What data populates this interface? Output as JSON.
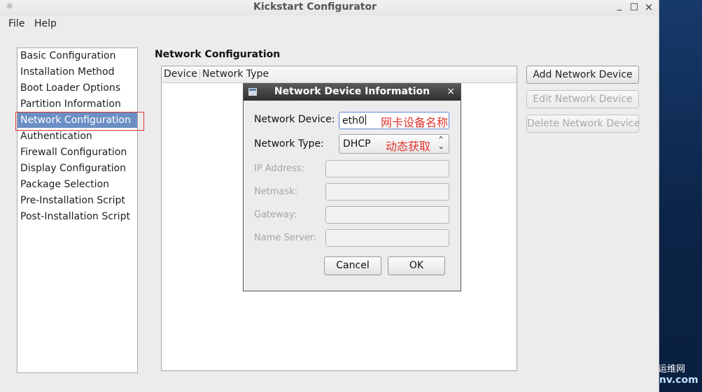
{
  "window": {
    "title": "Kickstart Configurator",
    "minimize": "_",
    "maximize": "□",
    "close": "×"
  },
  "menu": [
    "File",
    "Help"
  ],
  "nav": {
    "items": [
      "Basic Configuration",
      "Installation Method",
      "Boot Loader Options",
      "Partition Information",
      "Network Configuration",
      "Authentication",
      "Firewall Configuration",
      "Display Configuration",
      "Package Selection",
      "Pre-Installation Script",
      "Post-Installation Script"
    ],
    "selected": "Network Configuration"
  },
  "main": {
    "section_title": "Network Configuration",
    "columns": [
      "Device",
      "Network Type"
    ],
    "buttons": {
      "add": "Add Network Device",
      "edit": "Edit Network Device",
      "delete": "Delete Network Device"
    }
  },
  "dialog": {
    "title": "Network Device Information",
    "close": "×",
    "labels": {
      "device": "Network Device:",
      "type": "Network Type:",
      "ip": "IP Address:",
      "netmask": "Netmask:",
      "gateway": "Gateway:",
      "nameserver": "Name Server:"
    },
    "device_value": "eth0",
    "type_value": "DHCP",
    "annotations": {
      "device": "网卡设备名称",
      "type": "动态获取"
    },
    "cancel": "Cancel",
    "ok": "OK"
  },
  "watermark": {
    "cn": "运维网",
    "en": "iyunv.com"
  },
  "colors": {
    "selection": "#6b8fc4",
    "annotation": "#e0332b",
    "dialog_titlebar": "#3a3a3a"
  }
}
